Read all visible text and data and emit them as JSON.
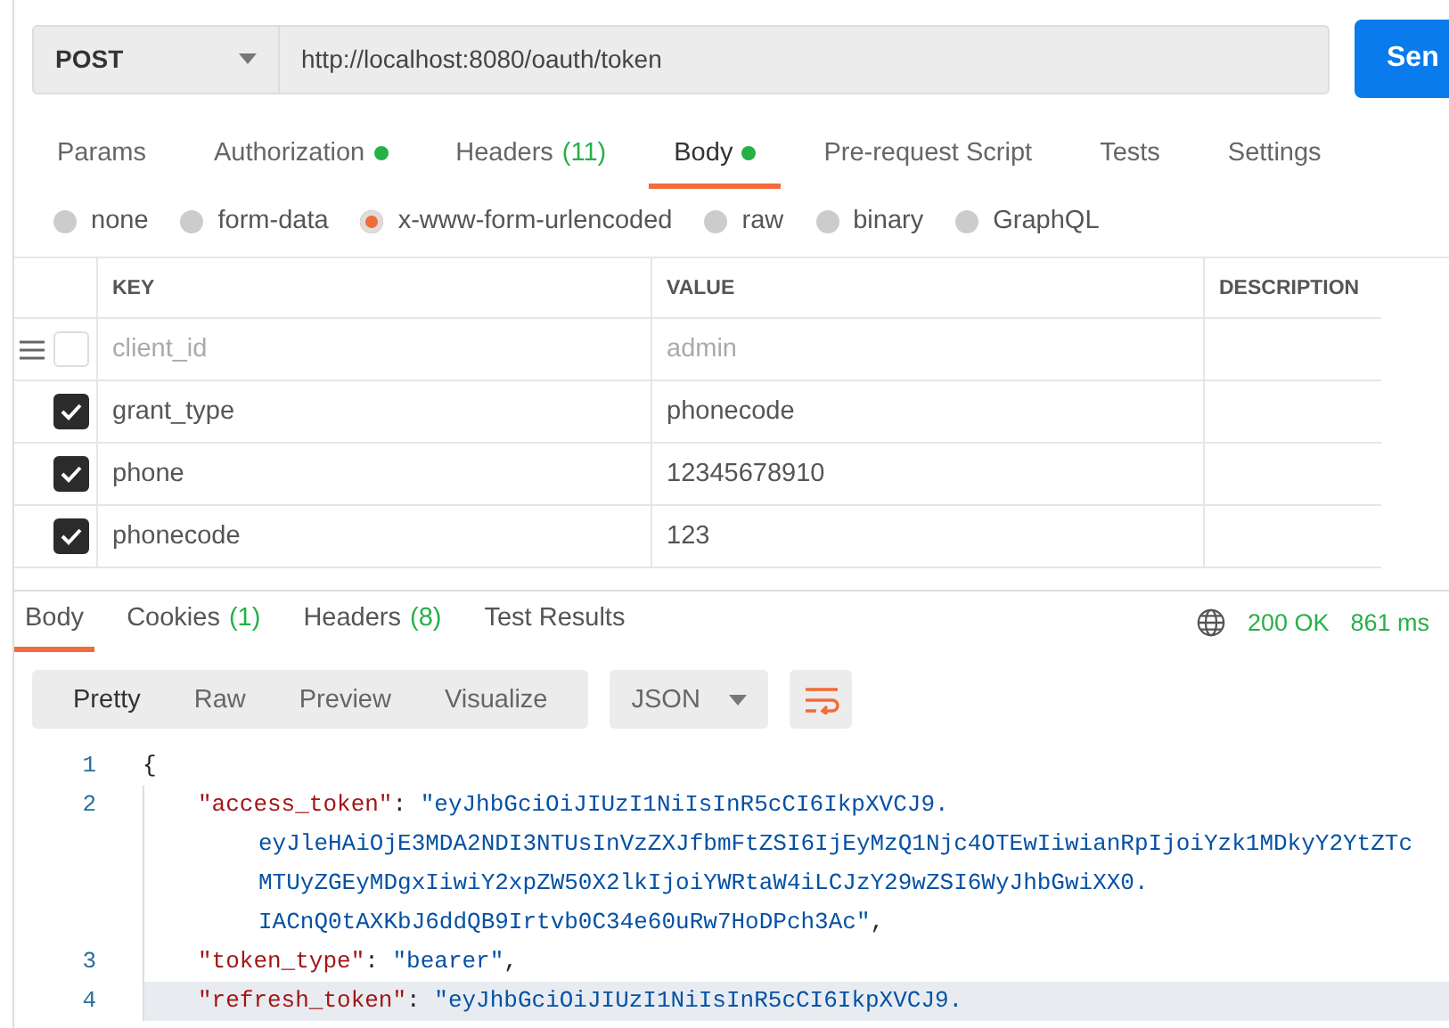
{
  "request": {
    "method": "POST",
    "url": "http://localhost:8080/oauth/token",
    "send_label": "Sen"
  },
  "request_tabs": [
    {
      "label": "Params",
      "dot": false,
      "selected": false
    },
    {
      "label": "Authorization",
      "dot": true,
      "selected": false
    },
    {
      "label": "Headers",
      "count": "(11)",
      "dot": false,
      "selected": false
    },
    {
      "label": "Body",
      "dot": true,
      "selected": true
    },
    {
      "label": "Pre-request Script",
      "dot": false,
      "selected": false
    },
    {
      "label": "Tests",
      "dot": false,
      "selected": false
    },
    {
      "label": "Settings",
      "dot": false,
      "selected": false
    }
  ],
  "body_types": [
    {
      "label": "none",
      "selected": false
    },
    {
      "label": "form-data",
      "selected": false
    },
    {
      "label": "x-www-form-urlencoded",
      "selected": true
    },
    {
      "label": "raw",
      "selected": false
    },
    {
      "label": "binary",
      "selected": false
    },
    {
      "label": "GraphQL",
      "selected": false
    }
  ],
  "params_table": {
    "columns": [
      "KEY",
      "VALUE",
      "DESCRIPTION"
    ],
    "rows": [
      {
        "key": "client_id",
        "value": "admin",
        "checked": false
      },
      {
        "key": "grant_type",
        "value": "phonecode",
        "checked": true
      },
      {
        "key": "phone",
        "value": "12345678910",
        "checked": true
      },
      {
        "key": "phonecode",
        "value": "123",
        "checked": true
      }
    ]
  },
  "response_tabs": [
    {
      "label": "Body",
      "selected": true
    },
    {
      "label": "Cookies",
      "count": "(1)",
      "selected": false
    },
    {
      "label": "Headers",
      "count": "(8)",
      "selected": false
    },
    {
      "label": "Test Results",
      "selected": false
    }
  ],
  "status": {
    "code": "200 OK",
    "time": "861 ms"
  },
  "view_modes": [
    {
      "label": "Pretty",
      "selected": true
    },
    {
      "label": "Raw",
      "selected": false
    },
    {
      "label": "Preview",
      "selected": false
    },
    {
      "label": "Visualize",
      "selected": false
    }
  ],
  "format": "JSON",
  "code_lines": [
    {
      "number": "1",
      "kind": "punct",
      "text": "{",
      "highlighted": false
    },
    {
      "number": "2",
      "kind": "pair",
      "key": "\"access_token\"",
      "colon": ":",
      "value_lines": [
        "\"eyJhbGciOiJIUzI1NiIsInR5cCI6IkpXVCJ9.",
        "eyJleHAiOjE3MDA2NDI3NTUsInVzZXJfbmFtZSI6IjEyMzQ1Njc4OTEwIiwianRpIjoiYzk1MDkyY2YtZTc",
        "MTUyZGEyMDgxIiwiY2xpZW50X2lkIjoiYWRtaW4iLCJzY29wZSI6WyJhbGwiXX0.",
        "IACnQ0tAXKbJ6ddQB9Irtvb0C34e60uRw7HoDPch3Ac\""
      ],
      "trailing": ",",
      "highlighted": false
    },
    {
      "number": "3",
      "kind": "pair",
      "key": "\"token_type\"",
      "colon": ":",
      "value_lines": [
        "\"bearer\""
      ],
      "trailing": ",",
      "highlighted": false
    },
    {
      "number": "4",
      "kind": "pair",
      "key": "\"refresh_token\"",
      "colon": ":",
      "value_lines": [
        "\"eyJhbGciOiJIUzI1NiIsInR5cCI6IkpXVCJ9."
      ],
      "highlighted": true
    }
  ]
}
